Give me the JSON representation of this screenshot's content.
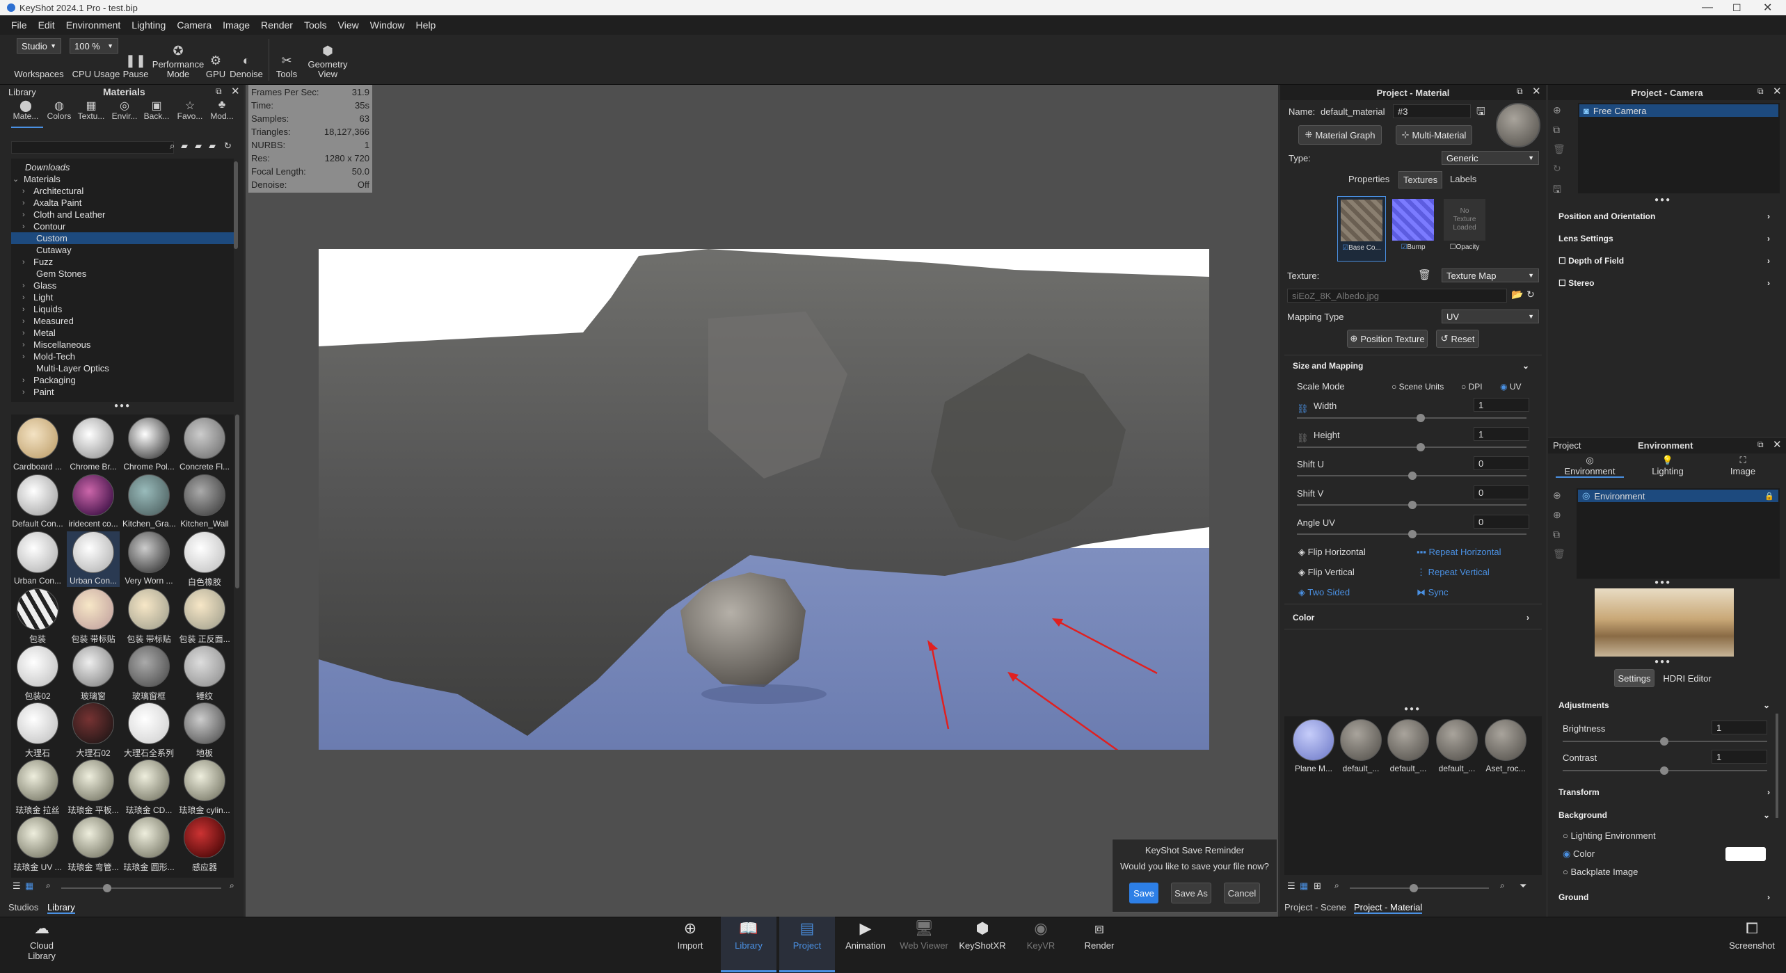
{
  "window": {
    "title": "KeyShot 2024.1 Pro - test.bip"
  },
  "menu": [
    "File",
    "Edit",
    "Environment",
    "Lighting",
    "Camera",
    "Image",
    "Render",
    "Tools",
    "View",
    "Window",
    "Help"
  ],
  "toolbar": {
    "workspace_value": "Studio",
    "cpu_value": "100 %",
    "workspaces": "Workspaces",
    "cpu": "CPU Usage",
    "pause": "Pause",
    "perf_line1": "Performance",
    "perf_line2": "Mode",
    "gpu": "GPU",
    "denoise": "Denoise",
    "tools": "Tools",
    "geom_line1": "Geometry",
    "geom_line2": "View"
  },
  "library": {
    "label": "Library",
    "title": "Materials",
    "tabs": [
      "Mate...",
      "Colors",
      "Textu...",
      "Envir...",
      "Back...",
      "Favo...",
      "Mod..."
    ],
    "tree": {
      "downloads": "Downloads",
      "root": "Materials",
      "items": [
        "Architectural",
        "Axalta Paint",
        "Cloth and Leather",
        "Contour",
        "Custom",
        "Cutaway",
        "Fuzz",
        "Gem Stones",
        "Glass",
        "Light",
        "Liquids",
        "Measured",
        "Metal",
        "Miscellaneous",
        "Mold-Tech",
        "Multi-Layer Optics",
        "Packaging",
        "Paint"
      ]
    },
    "thumbs": [
      "Cardboard ...",
      "Chrome Br...",
      "Chrome Pol...",
      "Concrete Fl...",
      "Default Con...",
      "iridecent co...",
      "Kitchen_Gra...",
      "Kitchen_Wall",
      "Urban Con...",
      "Urban Con...",
      "Very Worn ...",
      "白色橡胶",
      "包装",
      "包装 带标贴",
      "包装 带标贴",
      "包装 正反面...",
      "包装02",
      "玻璃窗",
      "玻璃窗框",
      "锤纹",
      "大理石",
      "大理石02",
      "大理石全系列",
      "地板",
      "珐琅金 拉丝",
      "珐琅金 平板...",
      "珐琅金 CD...",
      "珐琅金 cylin...",
      "珐琅金 UV ...",
      "珐琅金 弯管...",
      "珐琅金 圆形...",
      "感应器"
    ],
    "bottom_tabs": [
      "Studios",
      "Library"
    ]
  },
  "stats": [
    {
      "k": "Frames Per Sec:",
      "v": "31.9"
    },
    {
      "k": "Time:",
      "v": "35s"
    },
    {
      "k": "Samples:",
      "v": "63"
    },
    {
      "k": "Triangles:",
      "v": "18,127,366"
    },
    {
      "k": "NURBS:",
      "v": "1"
    },
    {
      "k": "Res:",
      "v": "1280 x 720"
    },
    {
      "k": "Focal Length:",
      "v": "50.0"
    },
    {
      "k": "Denoise:",
      "v": "Off"
    }
  ],
  "reminder": {
    "title": "KeyShot Save Reminder",
    "question": "Would you like to save your file now?",
    "save": "Save",
    "save_as": "Save As",
    "cancel": "Cancel"
  },
  "material": {
    "title": "Project - Material",
    "name_label": "Name:",
    "name_value": "default_material",
    "name_suffix": "#3",
    "graph_btn": "Material Graph",
    "multi_btn": "Multi-Material",
    "type_label": "Type:",
    "type_value": "Generic",
    "tabs": [
      "Properties",
      "Textures",
      "Labels"
    ],
    "tex_slots": [
      "Base Co...",
      "Bump",
      "Opacity"
    ],
    "no_tex_line1": "No",
    "no_tex_line2": "Texture",
    "no_tex_line3": "Loaded",
    "texture_label": "Texture:",
    "texture_type": "Texture Map",
    "texture_file": "siEoZ_8K_Albedo.jpg",
    "mapping_label": "Mapping Type",
    "mapping_value": "UV",
    "pos_btn": "Position Texture",
    "reset_btn": "Reset",
    "size_section": "Size and Mapping",
    "scale_label": "Scale Mode",
    "scale_opts": [
      "Scene Units",
      "DPI",
      "UV"
    ],
    "width_label": "Width",
    "width_value": "1",
    "height_label": "Height",
    "height_value": "1",
    "shiftu_label": "Shift U",
    "shiftu_value": "0",
    "shiftv_label": "Shift V",
    "shiftv_value": "0",
    "angle_label": "Angle UV",
    "angle_value": "0",
    "flip_h": "Flip Horizontal",
    "flip_v": "Flip Vertical",
    "two_sided": "Two Sided",
    "repeat_h": "Repeat Horizontal",
    "repeat_v": "Repeat Vertical",
    "sync": "Sync",
    "color_section": "Color",
    "mats": [
      "Plane M...",
      "default_...",
      "default_...",
      "default_...",
      "Aset_roc..."
    ],
    "bottom_tabs": [
      "Project - Scene",
      "Project - Material"
    ]
  },
  "camera": {
    "title": "Project - Camera",
    "item": "Free Camera",
    "sections": [
      "Position and Orientation",
      "Lens Settings",
      "Depth of Field",
      "Stereo"
    ]
  },
  "environment": {
    "project_label": "Project",
    "title": "Environment",
    "tabs": [
      "Environment",
      "Lighting",
      "Image"
    ],
    "item": "Environment",
    "settings_btn": "Settings",
    "hdri_btn": "HDRI Editor",
    "adjust_section": "Adjustments",
    "brightness_label": "Brightness",
    "brightness_value": "1",
    "contrast_label": "Contrast",
    "contrast_value": "1",
    "transform_section": "Transform",
    "background_section": "Background",
    "bg_opts": [
      "Lighting Environment",
      "Color",
      "Backplate Image"
    ],
    "bg_color": "#ffffff",
    "ground_section": "Ground"
  },
  "bottom": {
    "cloud_line1": "Cloud",
    "cloud_line2": "Library",
    "items": [
      "Import",
      "Library",
      "Project",
      "Animation",
      "Web Viewer",
      "KeyShotXR",
      "KeyVR",
      "Render"
    ],
    "screenshot": "Screenshot"
  }
}
